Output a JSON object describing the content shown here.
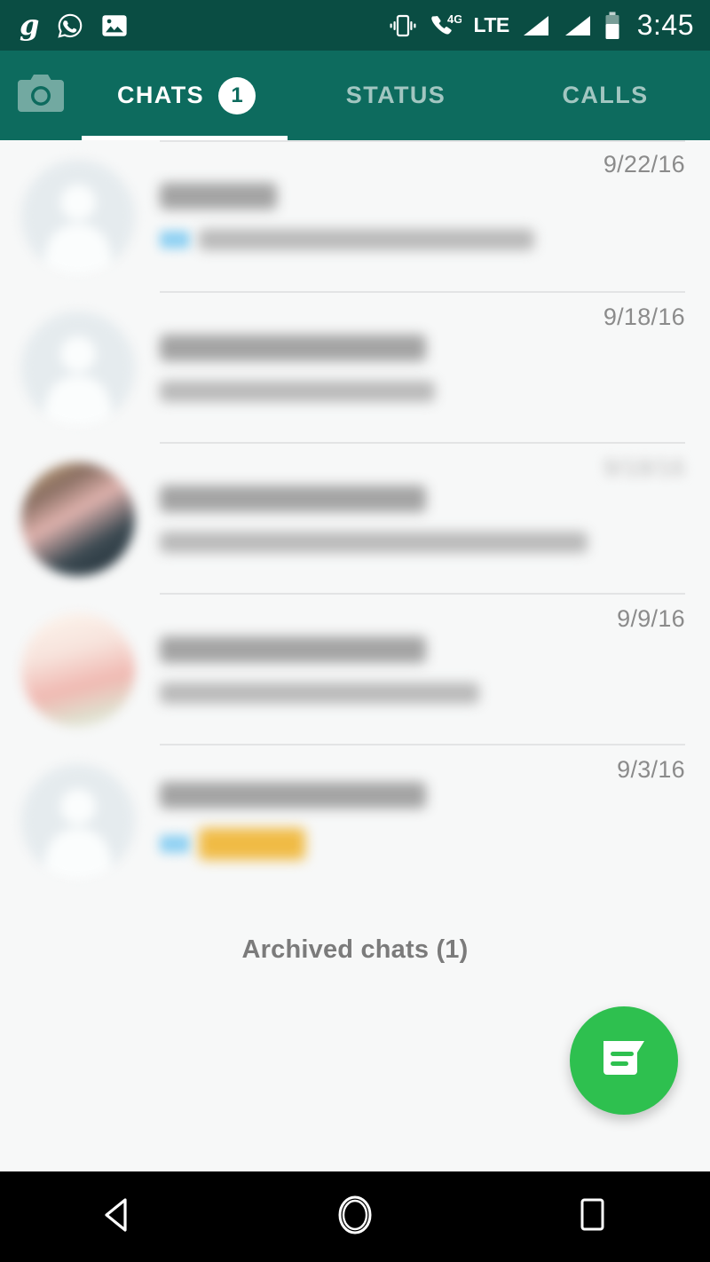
{
  "status_bar": {
    "left_icons": [
      {
        "name": "g-app-icon",
        "glyph": "g"
      },
      {
        "name": "whatsapp-icon",
        "glyph": ""
      },
      {
        "name": "photo-icon",
        "glyph": ""
      }
    ],
    "vibrate_icon": "vibrate-icon",
    "call_4g_icon": "call-4g-icon",
    "network_label": "LTE",
    "signal_icons": [
      "signal-bars-sim1-icon",
      "signal-bars-sim2-icon"
    ],
    "battery_icon": "battery-icon",
    "time": "3:45"
  },
  "toolbar": {
    "camera_tab": "camera-icon",
    "tabs": [
      {
        "label": "CHATS",
        "badge": "1",
        "active": true
      },
      {
        "label": "STATUS",
        "badge": "",
        "active": false
      },
      {
        "label": "CALLS",
        "badge": "",
        "active": false
      }
    ]
  },
  "chat_list": {
    "rows": [
      {
        "avatar": "default-person-avatar",
        "name_redacted": true,
        "name_width": 132,
        "preview_redacted": true,
        "preview_width": 378,
        "has_read_receipt": true,
        "highlight": false,
        "date": "9/22/16",
        "date_redacted": false
      },
      {
        "avatar": "default-person-avatar",
        "name_redacted": true,
        "name_width": 300,
        "preview_redacted": true,
        "preview_width": 310,
        "has_read_receipt": false,
        "highlight": false,
        "date": "9/18/16",
        "date_redacted": false
      },
      {
        "avatar": "contact-photo-avatar",
        "name_redacted": true,
        "name_width": 300,
        "preview_redacted": true,
        "preview_width": 540,
        "has_read_receipt": false,
        "highlight": false,
        "date": "9/18/16",
        "date_redacted": true
      },
      {
        "avatar": "contact-photo-avatar",
        "name_redacted": true,
        "name_width": 300,
        "preview_redacted": true,
        "preview_width": 360,
        "has_read_receipt": false,
        "highlight": false,
        "date": "9/9/16",
        "date_redacted": false
      },
      {
        "avatar": "default-person-avatar",
        "name_redacted": true,
        "name_width": 300,
        "preview_redacted": true,
        "preview_width": 120,
        "has_read_receipt": true,
        "highlight": true,
        "date": "9/3/16",
        "date_redacted": false
      }
    ],
    "archived_label": "Archived chats (1)"
  },
  "fab": {
    "icon": "new-chat-message-icon"
  },
  "nav_bar": {
    "back": "back-triangle-icon",
    "home": "home-circle-icon",
    "recents": "recents-square-icon"
  },
  "colors": {
    "status_bar_bg": "#0a4d43",
    "toolbar_bg": "#0d6b5e",
    "list_bg": "#f7f8f8",
    "fab_green": "#2ec04f",
    "date_text": "#8b8b8b",
    "archived_text": "#7b7b7b",
    "highlight_amber": "#f0bb45",
    "nav_bar_bg": "#000000"
  }
}
